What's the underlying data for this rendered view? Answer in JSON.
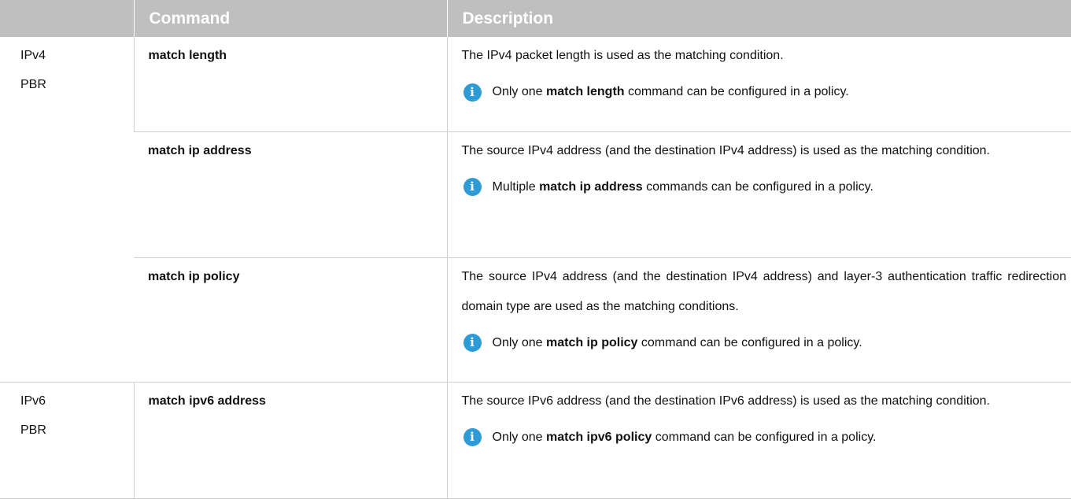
{
  "table": {
    "headers": [
      "",
      "Command",
      "Description"
    ],
    "rows": [
      {
        "group_line1": "IPv4",
        "group_line2": "PBR",
        "command": "match length",
        "description": "The IPv4 packet length is used as the matching condition.",
        "note": {
          "pre": "Only one ",
          "bold": "match length",
          "post": " command can be configured in a policy."
        }
      },
      {
        "command": "match ip address",
        "description": "The source IPv4 address (and the destination IPv4 address) is used as the matching condition.",
        "note": {
          "pre": "Multiple ",
          "bold": "match ip address",
          "post": " commands can be configured in a policy."
        }
      },
      {
        "command": "match ip policy",
        "description": "The source IPv4 address (and the destination IPv4 address) and layer-3 authentication traffic redirection domain type are used as the matching conditions.",
        "note": {
          "pre": "Only one ",
          "bold": "match ip policy",
          "post": " command can be configured in a policy."
        }
      },
      {
        "group_line1": "IPv6",
        "group_line2": "PBR",
        "command": "match ipv6 address",
        "description": "The source IPv6 address (and the destination IPv6 address) is used as the matching condition.",
        "note": {
          "pre": "Only one ",
          "bold": "match ipv6 policy",
          "post": " command can be configured in a policy."
        }
      }
    ]
  },
  "icons": {
    "note": "info-icon",
    "note_glyph": "i"
  },
  "colors": {
    "header_bg": "#bfbfbf",
    "header_text": "#ffffff",
    "info_icon": "#2e9bd6",
    "grid": "#cfcfcf"
  }
}
